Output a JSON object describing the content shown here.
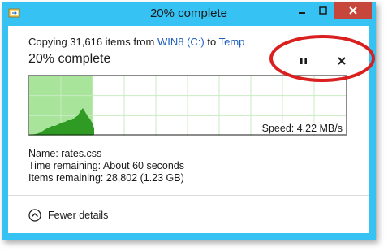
{
  "window": {
    "title": "20% complete",
    "accent_color": "#36c3f4",
    "close_color": "#c7463b"
  },
  "copy": {
    "prefix": "Copying 31,616 items from ",
    "source": "WIN8 (C:)",
    "to_word": " to ",
    "destination": "Temp",
    "headline": "20% complete",
    "progress": 0.2
  },
  "graph": {
    "speed_text": "Speed: 4.22 MB/s",
    "fill_color": "#a8e49a",
    "area_color": "#2f9a24"
  },
  "details": {
    "name": "Name:  rates.css",
    "time_remaining": "Time remaining:  About 60 seconds",
    "items_remaining": "Items remaining:  28,802 (1.23 GB)"
  },
  "footer": {
    "toggle_label": "Fewer details"
  },
  "icons": {
    "app": "file-copy-icon",
    "pause": "pause-icon",
    "cancel": "close-icon",
    "toggle": "chevron-up-circle-icon"
  },
  "annotation": {
    "highlight_color": "#d9201e"
  }
}
